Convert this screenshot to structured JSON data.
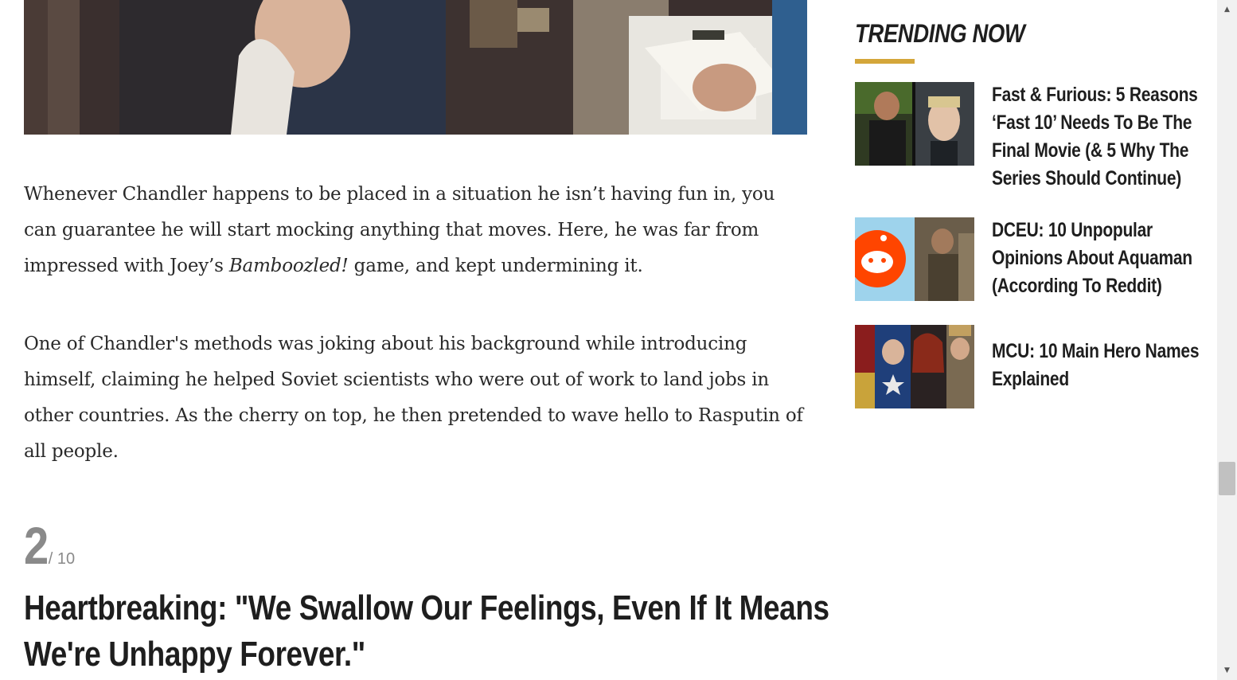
{
  "article": {
    "paragraph_1": {
      "before": "Whenever Chandler happens to be placed in a situation he isn’t having fun in, you can guarantee he will start mocking anything that moves. Here, he was far from impressed with Joey’s ",
      "emphasis": "Bamboozled!",
      "after": " game, and kept undermining it."
    },
    "paragraph_2": "One of Chandler's methods was joking about his background while introducing himself, claiming he helped Soviet scientists who were out of work to land jobs in other countries. As the cherry on top, he then pretended to wave hello to Rasputin of all people.",
    "entry": {
      "number": "2",
      "total": "/ 10",
      "title_line_1": "Heartbreaking: \"We Swallow Our Feelings, Even If It Means",
      "title_line_2": "We're Unhappy Forever.\""
    }
  },
  "sidebar": {
    "heading": "TRENDING NOW",
    "accent_color": "#d4a63a",
    "items": [
      {
        "title": "Fast & Furious: 5 Reasons ‘Fast 10’ Needs To Be The Final Movie (& 5 Why The Series Should Continue)"
      },
      {
        "title": "DCEU: 10 Unpopular Opinions About Aquaman (According To Reddit)"
      },
      {
        "title": "MCU: 10 Main Hero Names Explained"
      }
    ]
  },
  "scrollbar": {
    "up_icon": "▲",
    "down_icon": "▼"
  }
}
